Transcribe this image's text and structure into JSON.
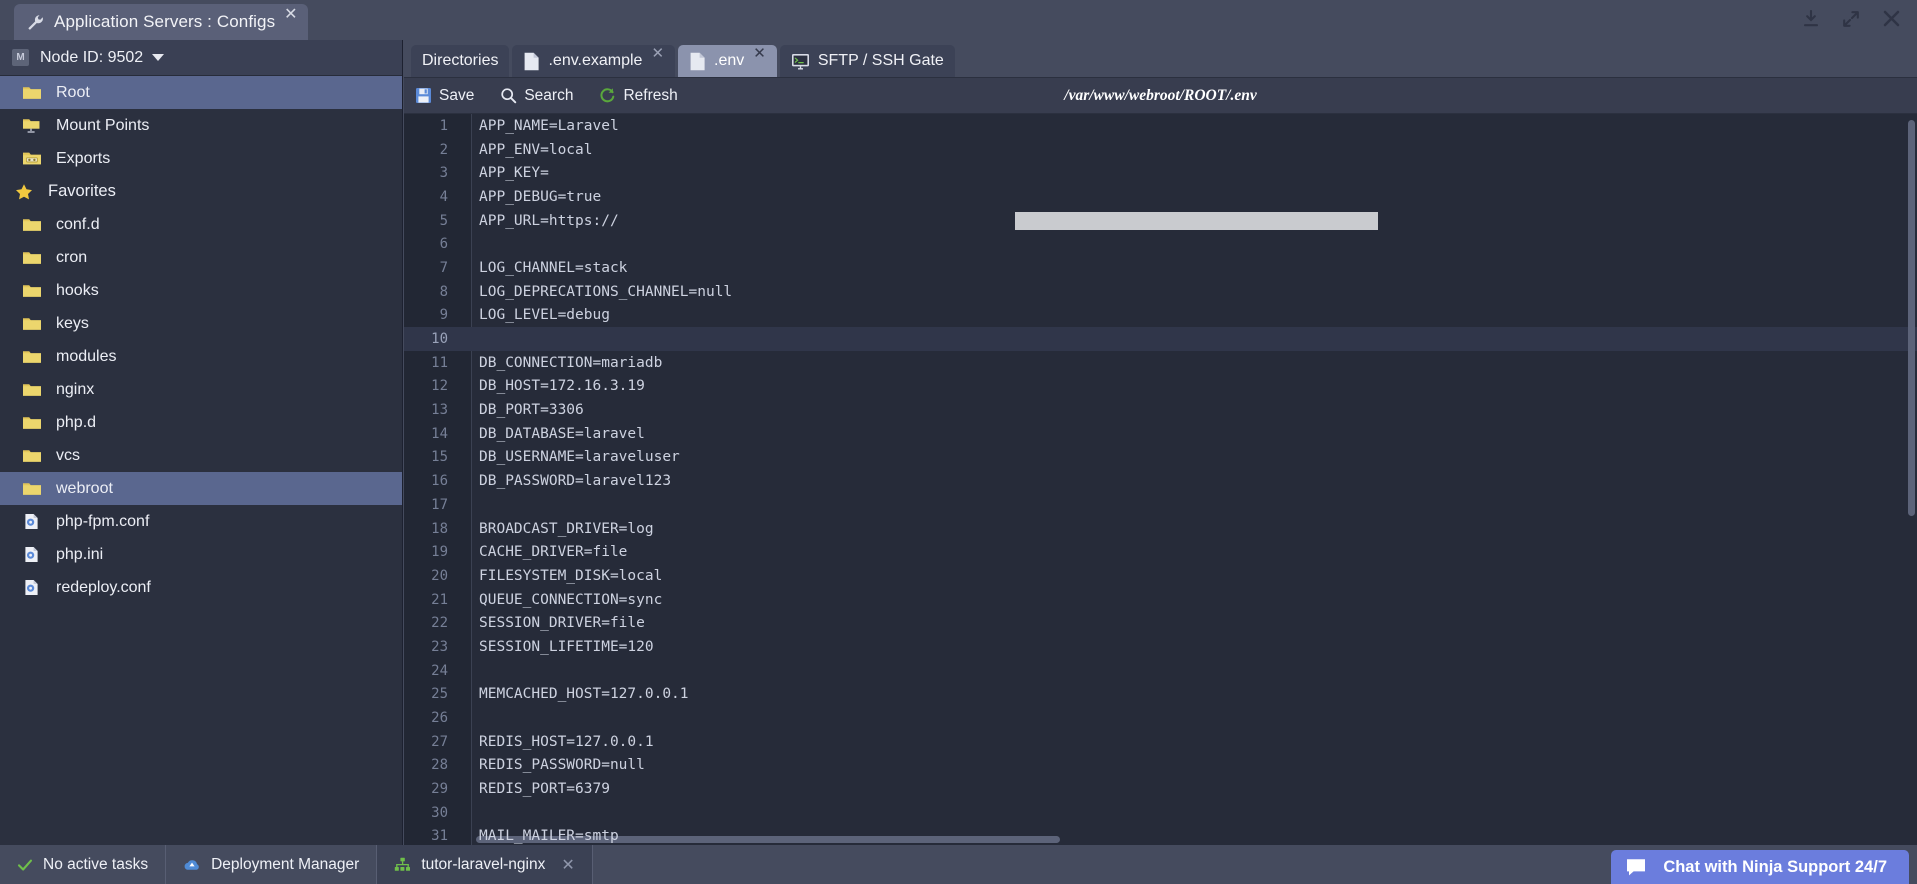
{
  "window": {
    "app_tab_title": "Application Servers : Configs",
    "app_tab_icon": "wrench-icon",
    "app_tab_close": "✕",
    "controls": [
      {
        "name": "download-icon",
        "glyph": "download"
      },
      {
        "name": "expand-icon",
        "glyph": "expand"
      },
      {
        "name": "close-icon",
        "glyph": "close"
      }
    ]
  },
  "sidebar": {
    "node_badge": "M",
    "node_label": "Node ID: 9502",
    "items": [
      {
        "label": "Root",
        "icon": "folder-icon",
        "kind": "folder",
        "selected": true,
        "section": false
      },
      {
        "label": "Mount Points",
        "icon": "folder-mount-icon",
        "kind": "mount",
        "selected": false,
        "section": false
      },
      {
        "label": "Exports",
        "icon": "folder-export-icon",
        "kind": "export",
        "selected": false,
        "section": false
      },
      {
        "label": "Favorites",
        "icon": "star-icon",
        "kind": "star",
        "selected": false,
        "section": true
      },
      {
        "label": "conf.d",
        "icon": "folder-icon",
        "kind": "folder",
        "selected": false,
        "section": false
      },
      {
        "label": "cron",
        "icon": "folder-icon",
        "kind": "folder",
        "selected": false,
        "section": false
      },
      {
        "label": "hooks",
        "icon": "folder-icon",
        "kind": "folder",
        "selected": false,
        "section": false
      },
      {
        "label": "keys",
        "icon": "folder-icon",
        "kind": "folder",
        "selected": false,
        "section": false
      },
      {
        "label": "modules",
        "icon": "folder-icon",
        "kind": "folder",
        "selected": false,
        "section": false
      },
      {
        "label": "nginx",
        "icon": "folder-icon",
        "kind": "folder",
        "selected": false,
        "section": false
      },
      {
        "label": "php.d",
        "icon": "folder-icon",
        "kind": "folder",
        "selected": false,
        "section": false
      },
      {
        "label": "vcs",
        "icon": "folder-icon",
        "kind": "folder",
        "selected": false,
        "section": false
      },
      {
        "label": "webroot",
        "icon": "folder-icon",
        "kind": "folder",
        "selected": true,
        "section": false
      },
      {
        "label": "php-fpm.conf",
        "icon": "config-file-icon",
        "kind": "conf",
        "selected": false,
        "section": false
      },
      {
        "label": "php.ini",
        "icon": "config-file-icon",
        "kind": "conf",
        "selected": false,
        "section": false
      },
      {
        "label": "redeploy.conf",
        "icon": "config-file-icon",
        "kind": "conf",
        "selected": false,
        "section": false
      }
    ]
  },
  "editor_tabs": [
    {
      "label": "Directories",
      "icon": "none",
      "active": false,
      "closable": false
    },
    {
      "label": ".env.example",
      "icon": "file-icon",
      "active": false,
      "closable": true
    },
    {
      "label": ".env",
      "icon": "file-icon",
      "active": true,
      "closable": true
    },
    {
      "label": "SFTP / SSH Gate",
      "icon": "terminal-icon",
      "active": false,
      "closable": false
    }
  ],
  "toolbar": {
    "save_label": "Save",
    "search_label": "Search",
    "refresh_label": "Refresh",
    "file_path": "/var/www/webroot/ROOT/.env"
  },
  "code": {
    "lines": [
      {
        "n": "1",
        "text": "APP_NAME=Laravel"
      },
      {
        "n": "2",
        "text": "APP_ENV=local"
      },
      {
        "n": "3",
        "text": "APP_KEY="
      },
      {
        "n": "4",
        "text": "APP_DEBUG=true"
      },
      {
        "n": "5",
        "text": "APP_URL=https://",
        "redacted": true
      },
      {
        "n": "6",
        "text": ""
      },
      {
        "n": "7",
        "text": "LOG_CHANNEL=stack"
      },
      {
        "n": "8",
        "text": "LOG_DEPRECATIONS_CHANNEL=null"
      },
      {
        "n": "9",
        "text": "LOG_LEVEL=debug"
      },
      {
        "n": "10",
        "text": "",
        "current": true
      },
      {
        "n": "11",
        "text": "DB_CONNECTION=mariadb"
      },
      {
        "n": "12",
        "text": "DB_HOST=172.16.3.19"
      },
      {
        "n": "13",
        "text": "DB_PORT=3306"
      },
      {
        "n": "14",
        "text": "DB_DATABASE=laravel"
      },
      {
        "n": "15",
        "text": "DB_USERNAME=laraveluser"
      },
      {
        "n": "16",
        "text": "DB_PASSWORD=laravel123"
      },
      {
        "n": "17",
        "text": ""
      },
      {
        "n": "18",
        "text": "BROADCAST_DRIVER=log"
      },
      {
        "n": "19",
        "text": "CACHE_DRIVER=file"
      },
      {
        "n": "20",
        "text": "FILESYSTEM_DISK=local"
      },
      {
        "n": "21",
        "text": "QUEUE_CONNECTION=sync"
      },
      {
        "n": "22",
        "text": "SESSION_DRIVER=file"
      },
      {
        "n": "23",
        "text": "SESSION_LIFETIME=120"
      },
      {
        "n": "24",
        "text": ""
      },
      {
        "n": "25",
        "text": "MEMCACHED_HOST=127.0.0.1"
      },
      {
        "n": "26",
        "text": ""
      },
      {
        "n": "27",
        "text": "REDIS_HOST=127.0.0.1"
      },
      {
        "n": "28",
        "text": "REDIS_PASSWORD=null"
      },
      {
        "n": "29",
        "text": "REDIS_PORT=6379"
      },
      {
        "n": "30",
        "text": ""
      },
      {
        "n": "31",
        "text": "MAIL_MAILER=smtp"
      }
    ]
  },
  "statusbar": {
    "tasks_label": "No active tasks",
    "tasks_icon": "check-icon",
    "deployment_label": "Deployment Manager",
    "deployment_icon": "cloud-icon",
    "process_label": "tutor-laravel-nginx",
    "process_icon": "network-icon",
    "process_close": "✕",
    "chat_label": "Chat with Ninja Support 24/7",
    "chat_icon": "chat-bubble-icon"
  },
  "colors": {
    "chrome": "#454b5e",
    "sidebar": "#2b303f",
    "editor_bg": "#262b39",
    "selection": "#5a678f",
    "accent_chat": "#6b7ddd",
    "folder": "#e8c95d",
    "ok_green": "#6fbf4a"
  }
}
